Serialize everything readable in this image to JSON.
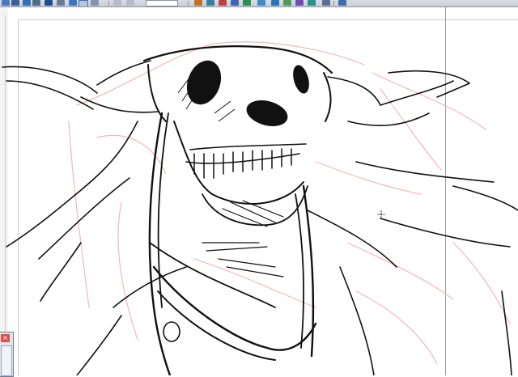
{
  "toolbar": {
    "icons": [
      "arrow-icon",
      "disk-icon",
      "layer-icon",
      "select-icon",
      "grid-icon",
      "page-icon",
      "zoom-field",
      "brush-icon",
      "pen-icon",
      "eraser-icon",
      "fill-icon",
      "ruler-icon",
      "text-icon",
      "move-icon",
      "transform-icon",
      "hand-icon",
      "table-icon"
    ]
  },
  "mini_window": {
    "close_glyph": "×"
  },
  "colors": {
    "ink": "#111111",
    "sketch": "#f0b8b8",
    "guide": "#9a9a9a",
    "frame": "#c9c9c9"
  }
}
